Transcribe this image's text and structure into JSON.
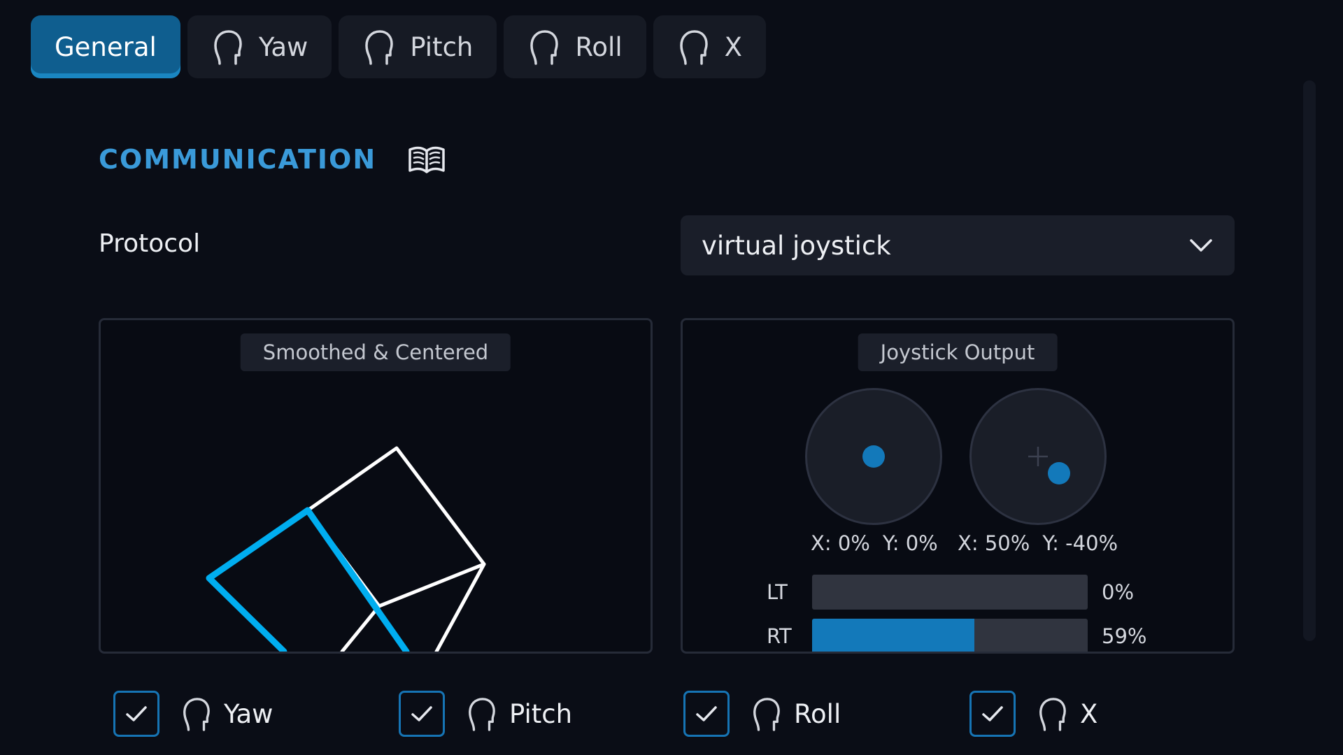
{
  "tabs": [
    {
      "label": "General",
      "active": true,
      "icon": "none"
    },
    {
      "label": "Yaw",
      "active": false,
      "icon": "head-icon"
    },
    {
      "label": "Pitch",
      "active": false,
      "icon": "head-icon"
    },
    {
      "label": "Roll",
      "active": false,
      "icon": "head-icon"
    },
    {
      "label": "X",
      "active": false,
      "icon": "head-icon"
    }
  ],
  "section": {
    "title": "COMMUNICATION",
    "doc_icon": "book-icon"
  },
  "protocol": {
    "label": "Protocol",
    "value": "virtual joystick"
  },
  "smoothed_panel": {
    "label": "Smoothed & Centered"
  },
  "joystick_panel": {
    "label": "Joystick Output",
    "left_stick": {
      "x_text": "X: 0%",
      "y_text": "Y: 0%",
      "x": 0,
      "y": 0
    },
    "right_stick": {
      "x_text": "X: 50%",
      "y_text": "Y: -40%",
      "x": 50,
      "y": -40
    },
    "triggers": [
      {
        "label": "LT",
        "value": 0,
        "text": "0%"
      },
      {
        "label": "RT",
        "value": 59,
        "text": "59%"
      }
    ]
  },
  "axes": [
    {
      "label": "Yaw",
      "checked": true
    },
    {
      "label": "Pitch",
      "checked": true
    },
    {
      "label": "Roll",
      "checked": true
    },
    {
      "label": "X",
      "checked": true
    }
  ],
  "colors": {
    "accent": "#3a9ad9",
    "active_tab": "#0f5e8f",
    "cube_highlight": "#00aef0"
  }
}
